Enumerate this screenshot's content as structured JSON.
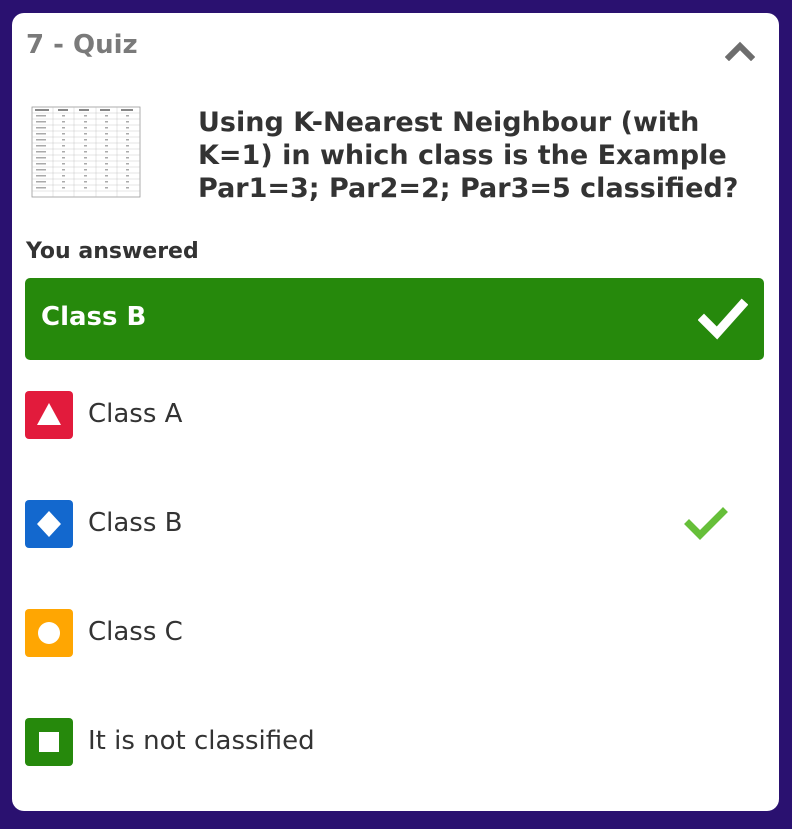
{
  "quiz": {
    "title": "7 - Quiz",
    "question": "Using K-Nearest Neighbour (with K=1) in which class is the Example Par1=3; Par2=2; Par3=5 classified?"
  },
  "answered": {
    "label": "You answered",
    "answer": "Class B"
  },
  "options": [
    {
      "label": "Class A",
      "shape": "triangle",
      "color": "#e21b3c",
      "correct": false
    },
    {
      "label": "Class B",
      "shape": "diamond",
      "color": "#1368ce",
      "correct": true
    },
    {
      "label": "Class C",
      "shape": "circle",
      "color": "#ffa602",
      "correct": false
    },
    {
      "label": "It is not classified",
      "shape": "square",
      "color": "#26890c",
      "correct": false
    }
  ],
  "colors": {
    "background": "#2a1170",
    "answer_banner": "#26890c",
    "check_green": "#66bf39"
  },
  "icons": {
    "collapse": "chevron-up-icon",
    "correct": "checkmark-icon"
  }
}
